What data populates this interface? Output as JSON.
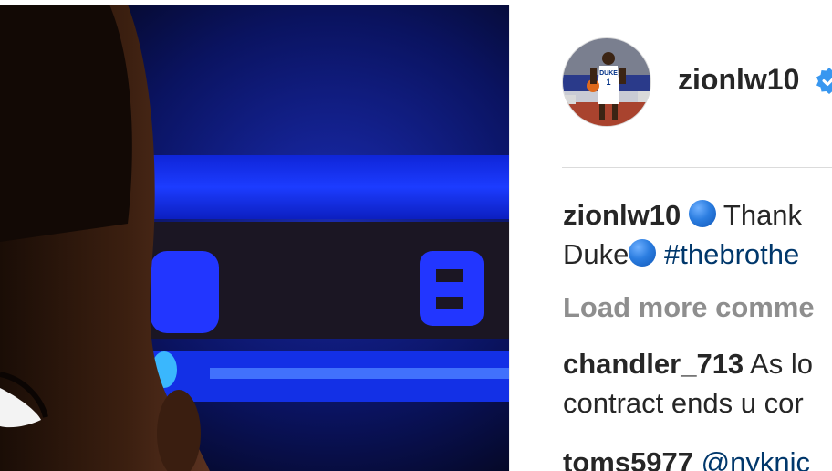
{
  "post": {
    "username": "zionlw10",
    "verified_icon": "verified-badge-icon",
    "caption": {
      "username": "zionlw10",
      "line1_text": "Thank",
      "line2_word": "Duke",
      "line2_hashtag": "#thebrothe"
    },
    "load_more_label": "Load more comme",
    "comments": [
      {
        "username": "chandler_713",
        "line1": "As lo",
        "line2": "contract ends u cor"
      },
      {
        "username": "toms5977",
        "mention": "@nyknic"
      }
    ]
  },
  "colors": {
    "link": "#00376b",
    "muted": "#8e8e8e",
    "text": "#262626",
    "verified": "#3897f0"
  }
}
